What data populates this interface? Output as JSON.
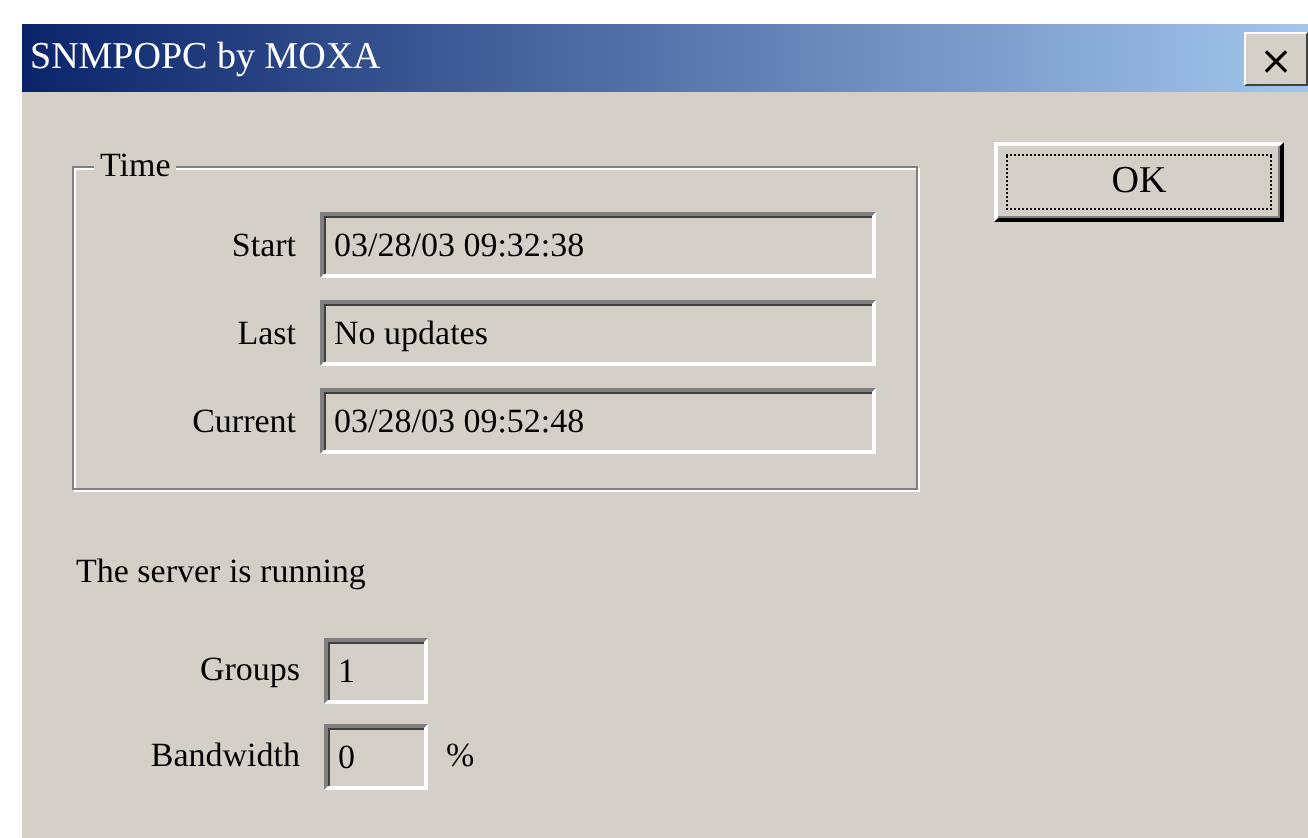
{
  "window": {
    "title": "SNMPOPC by MOXA",
    "close": "×"
  },
  "time_group": {
    "title": "Time",
    "fields": [
      {
        "label": "Start",
        "value": "03/28/03 09:32:38"
      },
      {
        "label": "Last",
        "value": "No updates"
      },
      {
        "label": "Current",
        "value": "03/28/03 09:52:48"
      }
    ]
  },
  "ok_button": "OK",
  "status": "The server is running",
  "stats": [
    {
      "label": "Groups",
      "value": "1"
    },
    {
      "label": "Bandwidth",
      "value": "0",
      "unit": "%"
    }
  ]
}
